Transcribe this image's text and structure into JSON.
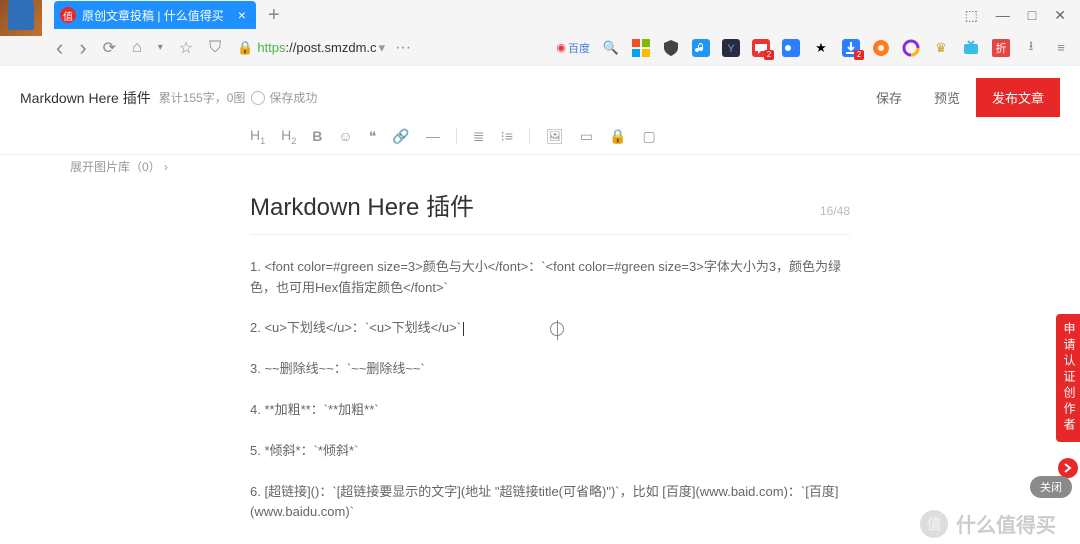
{
  "browser": {
    "tab_title": "原创文章投稿 | 什么值得买",
    "tab_favicon": "值",
    "plus": "+",
    "window": {
      "card": "⬚",
      "min": "—",
      "max": "□",
      "close": "✕"
    },
    "nav": {
      "back": "‹",
      "forward": "›",
      "reload": "⟳",
      "home": "⌂",
      "down": "▾",
      "star": "☆",
      "shield": "⛉"
    },
    "url": {
      "https": "https",
      "rest": "://post.smzdm.c",
      "dd": "▾",
      "ext_more": "···"
    },
    "ext_labels": {
      "baidu": "百度"
    }
  },
  "page": {
    "title": "Markdown Here 插件",
    "stat": "累计155字，0图",
    "saved": "保存成功",
    "actions": {
      "save": "保存",
      "preview": "预览",
      "publish": "发布文章"
    },
    "toolbar": [
      "H",
      "H",
      "B",
      "☺",
      "❝",
      "⥀",
      "—",
      "≔",
      "≕",
      "▭",
      "▭",
      "🔒",
      "▭"
    ],
    "expand": "展开图片库（0）",
    "ed_title": "Markdown Here 插件",
    "ed_count": "16/48",
    "body": [
      "1.  <font color=#green size=3>颜色与大小</font>：`<font color=#green size=3>字体大小为3，颜色为绿色，也可用Hex值指定颜色</font>`",
      "2. <u>下划线</u>：`<u>下划线</u>`",
      "3. ~~删除线~~：`~~删除线~~`",
      "4. **加粗**：`**加粗**`",
      "5. *倾斜*：`*倾斜*`",
      "6. [超链接]()：`[超链接要显示的文字](地址 \"超链接title(可省略)\")`，比如 [百度](www.baid.com)：`[百度](www.baidu.com)`"
    ],
    "ribbon": "申请认证创作者",
    "close_pill": "关闭",
    "watermark": "什么值得买"
  }
}
